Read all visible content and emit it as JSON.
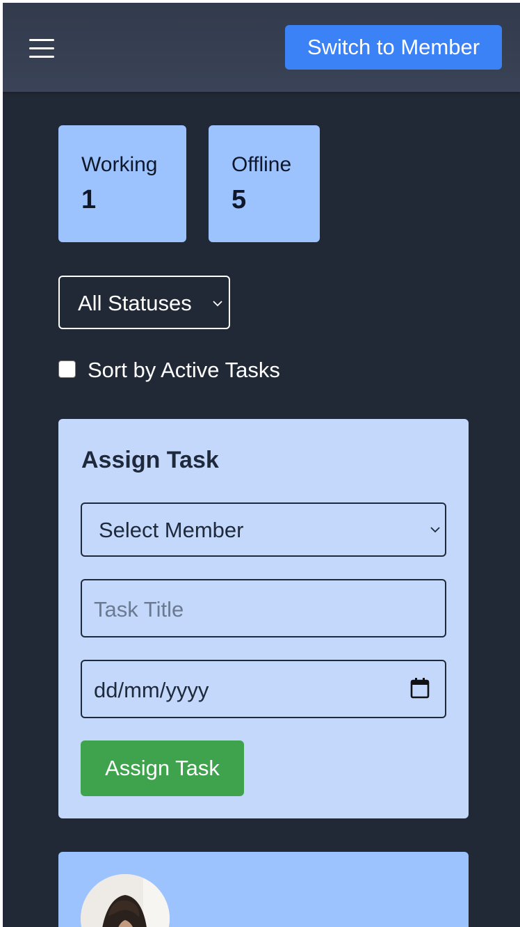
{
  "header": {
    "menu_icon": "hamburger-menu-icon",
    "switch_button_label": "Switch to Member",
    "switch_button_color": "#3b82f6"
  },
  "stats": [
    {
      "label": "Working",
      "value": "1"
    },
    {
      "label": "Offline",
      "value": "5"
    }
  ],
  "filters": {
    "status_select_value": "All Statuses",
    "sort_checkbox_label": "Sort by Active Tasks",
    "sort_checked": false
  },
  "assign_task": {
    "title": "Assign Task",
    "member_select_value": "Select Member",
    "task_title_placeholder": "Task Title",
    "date_placeholder": "dd/mm/yyyy",
    "submit_label": "Assign Task",
    "submit_color": "#3fa34d"
  },
  "member_card": {
    "avatar_icon": "member-avatar-photo"
  },
  "colors": {
    "background": "#222936",
    "card": "#9dc3ff",
    "panel": "#c3d8fb"
  }
}
